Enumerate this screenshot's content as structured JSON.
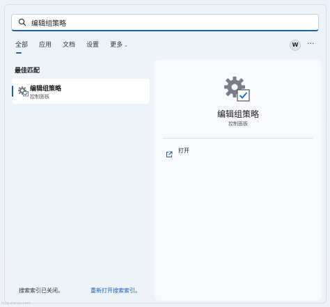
{
  "search": {
    "value": "编辑组策略",
    "placeholder": ""
  },
  "tabs": [
    {
      "label": "全部"
    },
    {
      "label": "应用"
    },
    {
      "label": "文档"
    },
    {
      "label": "设置"
    },
    {
      "label": "更多"
    }
  ],
  "profile": {
    "initial": "W",
    "more_label": "···"
  },
  "best_match": {
    "section_label": "最佳匹配",
    "title": "编辑组策略",
    "subtitle": "控制面板"
  },
  "detail": {
    "title": "编辑组策略",
    "subtitle": "控制面板",
    "open_label": "打开"
  },
  "footer": {
    "status_text": "搜索索引已关闭。",
    "reopen_link": "重新打开搜索索引。"
  },
  "watermark": {
    "text": "blog.ztanyu.com"
  },
  "colors": {
    "accent": "#1a5fb4",
    "panel_bg": "#eef3fa",
    "detail_bg": "#f7f9fc"
  }
}
